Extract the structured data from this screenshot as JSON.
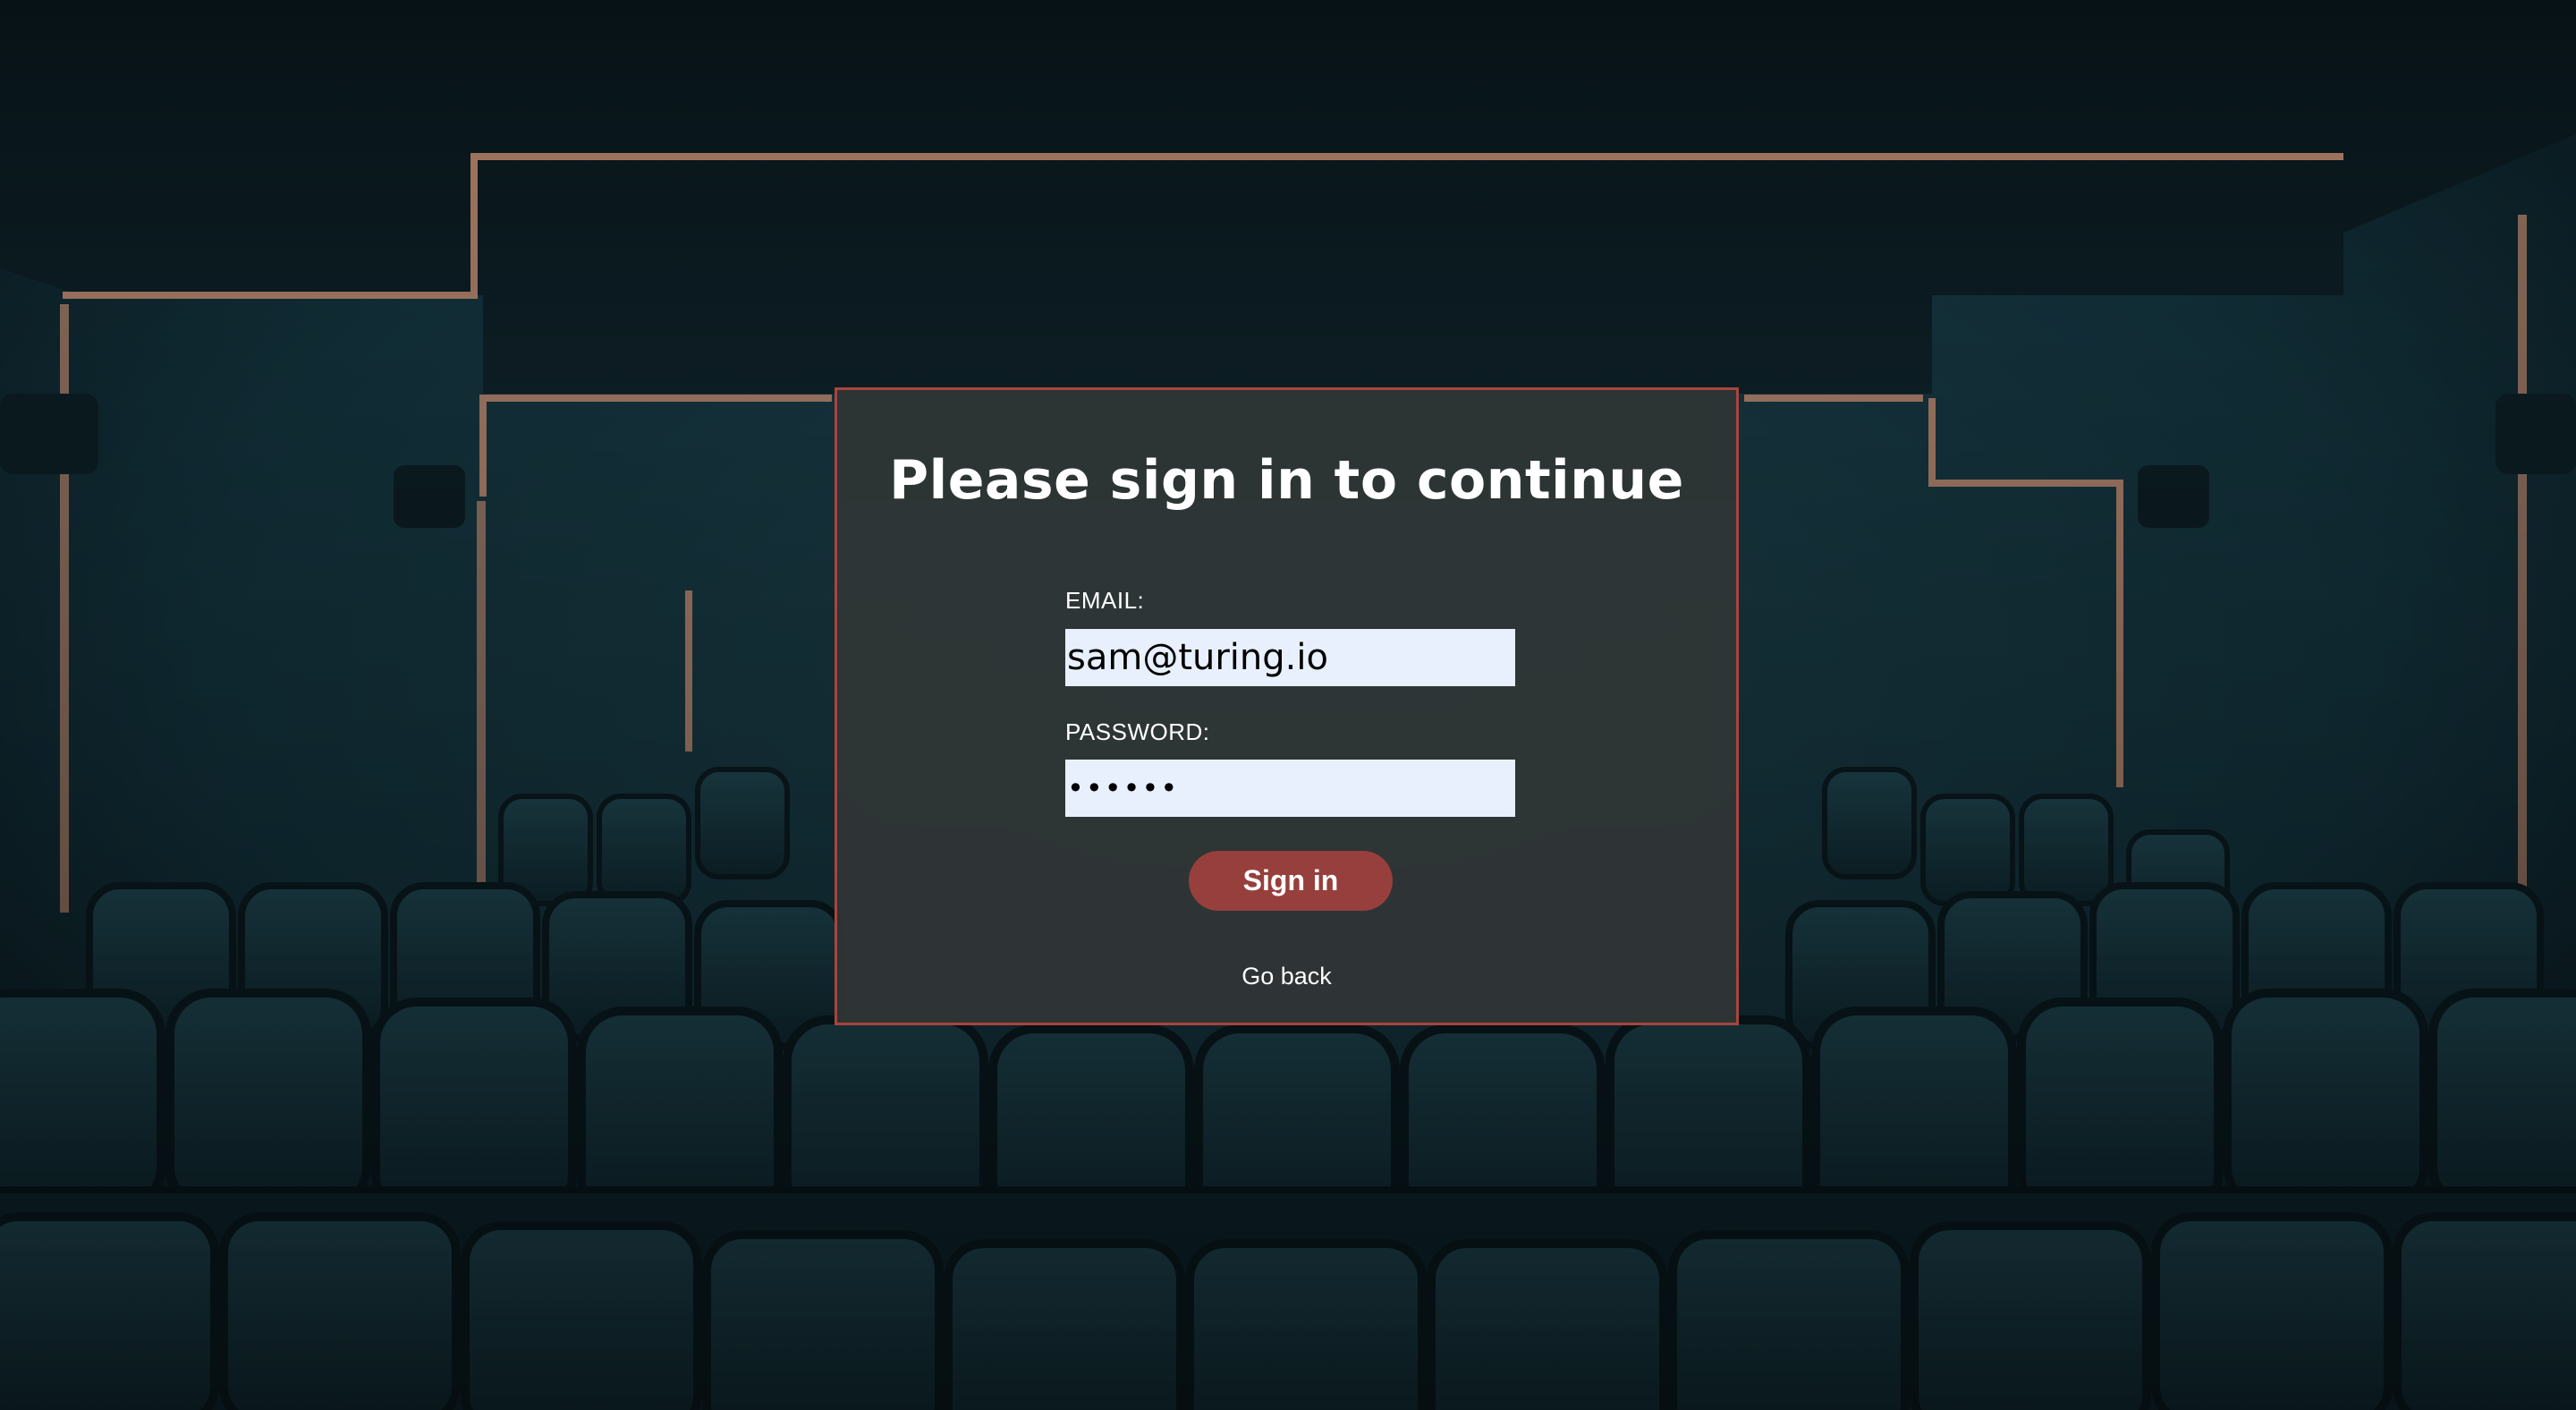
{
  "background": {
    "scene": "movie-theater-seats",
    "accent_color": "#c08a70",
    "base_color": "#0f2a33"
  },
  "modal": {
    "title": "Please sign in to continue",
    "border_color": "#a8453f",
    "email": {
      "label": "EMAIL:",
      "value": "sam@turing.io"
    },
    "password": {
      "label": "PASSWORD:",
      "value": "••••••"
    },
    "submit_label": "Sign in",
    "submit_color": "#973f3c",
    "back_link": "Go back"
  }
}
